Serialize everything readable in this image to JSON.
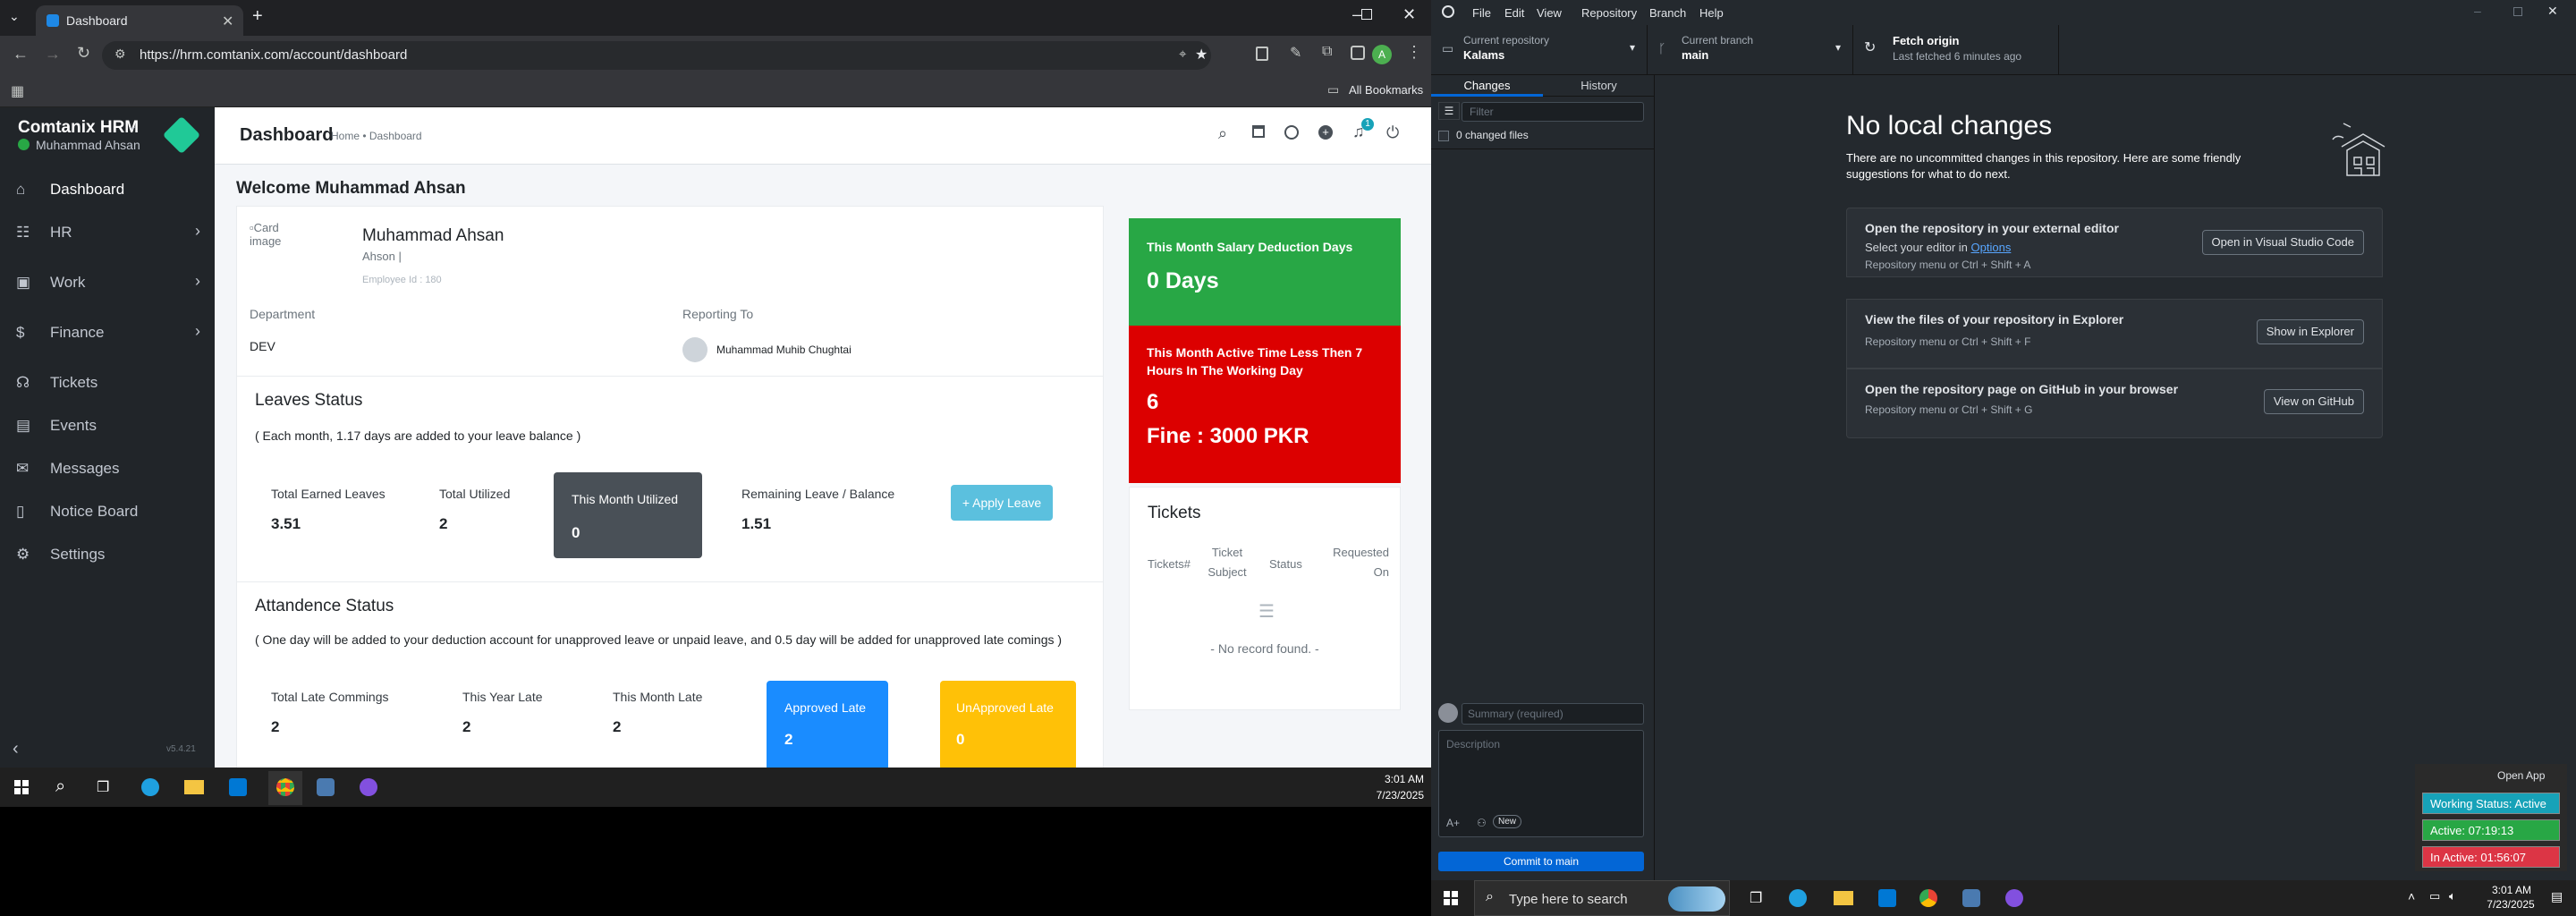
{
  "chrome": {
    "tab_title": "Dashboard",
    "url": "https://hrm.comtanix.com/account/dashboard",
    "all_bookmarks": "All Bookmarks",
    "profile_initial": "A"
  },
  "sidebar": {
    "brand": "Comtanix HRM",
    "user": "Muhammad Ahsan",
    "version": "v5.4.21",
    "items": [
      {
        "label": "Dashboard",
        "icon": "home-icon",
        "chevron": false
      },
      {
        "label": "HR",
        "icon": "users-icon",
        "chevron": true
      },
      {
        "label": "Work",
        "icon": "briefcase-icon",
        "chevron": true
      },
      {
        "label": "Finance",
        "icon": "dollar-icon",
        "chevron": true
      },
      {
        "label": "Tickets",
        "icon": "headset-icon",
        "chevron": false
      },
      {
        "label": "Events",
        "icon": "calendar-icon",
        "chevron": false
      },
      {
        "label": "Messages",
        "icon": "chat-icon",
        "chevron": false
      },
      {
        "label": "Notice Board",
        "icon": "clipboard-icon",
        "chevron": false
      },
      {
        "label": "Settings",
        "icon": "gear-icon",
        "chevron": false
      }
    ]
  },
  "header": {
    "title": "Dashboard",
    "breadcrumb": "Home • Dashboard",
    "notification_count": "1"
  },
  "welcome": "Welcome Muhammad Ahsan",
  "profile": {
    "image_alt": "Card image",
    "name": "Muhammad Ahsan",
    "sub": "Ahson |",
    "employee_id": "Employee Id : 180",
    "department_label": "Department",
    "department": "DEV",
    "reporting_label": "Reporting To",
    "reporting_to": "Muhammad Muhib Chughtai"
  },
  "leaves": {
    "title": "Leaves Status",
    "note": "( Each month, 1.17 days are added to your leave balance )",
    "total_earned_label": "Total Earned Leaves",
    "total_earned": "3.51",
    "total_utilized_label": "Total Utilized",
    "total_utilized": "2",
    "month_utilized_label": "This Month Utilized",
    "month_utilized": "0",
    "remaining_label": "Remaining Leave / Balance",
    "remaining": "1.51",
    "apply_button": "+ Apply Leave"
  },
  "attendance": {
    "title": "Attandence Status",
    "note": "( One day will be added to your deduction account for unapproved leave or unpaid leave, and 0.5 day will be added for unapproved late comings )",
    "total_late_label": "Total Late Commings",
    "total_late": "2",
    "year_late_label": "This Year Late",
    "year_late": "2",
    "month_late_label": "This Month Late",
    "month_late": "2",
    "approved_label": "Approved Late",
    "approved": "2",
    "unapproved_label": "UnApproved Late",
    "unapproved": "0"
  },
  "salary_card": {
    "title": "This Month Salary Deduction Days",
    "value": "0 Days",
    "color": "#28a745"
  },
  "active_card": {
    "title": "This Month Active Time Less Then 7 Hours In The Working Day",
    "value": "6",
    "fine": "Fine : 3000 PKR",
    "color": "#dc0000"
  },
  "tickets": {
    "title": "Tickets",
    "headers": [
      "Tickets#",
      "Ticket Subject",
      "Status",
      "Requested On"
    ],
    "empty": "- No record found. -"
  },
  "taskbar_left": {
    "time": "3:01 AM",
    "date": "7/23/2025"
  },
  "github": {
    "menu": [
      "File",
      "Edit",
      "View",
      "Repository",
      "Branch",
      "Help"
    ],
    "repo_label": "Current repository",
    "repo": "Kalams",
    "branch_label": "Current branch",
    "branch": "main",
    "fetch_title": "Fetch origin",
    "fetch_sub": "Last fetched 6 minutes ago",
    "tab_changes": "Changes",
    "tab_history": "History",
    "filter_placeholder": "Filter",
    "changed_files": "0 changed files",
    "no_changes_title": "No local changes",
    "no_changes_desc": "There are no uncommitted changes in this repository. Here are some friendly suggestions for what to do next.",
    "suggestions": [
      {
        "title": "Open the repository in your external editor",
        "desc_prefix": "Select your editor in ",
        "desc_link": "Options",
        "keys": "Repository menu or  Ctrl + Shift + A",
        "button": "Open in Visual Studio Code"
      },
      {
        "title": "View the files of your repository in Explorer",
        "desc_prefix": "",
        "desc_link": "",
        "keys": "Repository menu or  Ctrl + Shift + F",
        "button": "Show in Explorer"
      },
      {
        "title": "Open the repository page on GitHub in your browser",
        "desc_prefix": "",
        "desc_link": "",
        "keys": "Repository menu or  Ctrl + Shift + G",
        "button": "View on GitHub"
      }
    ],
    "summary_placeholder": "Summary (required)",
    "description_placeholder": "Description",
    "new_badge": "New",
    "commit_button": "Commit to main"
  },
  "widget": {
    "open_app": "Open App",
    "working_status": "Working Status: Active",
    "active": "Active: 07:19:13",
    "inactive": "In Active: 01:56:07"
  },
  "taskbar_right": {
    "search_placeholder": "Type here to search",
    "time": "3:01 AM",
    "date": "7/23/2025"
  }
}
